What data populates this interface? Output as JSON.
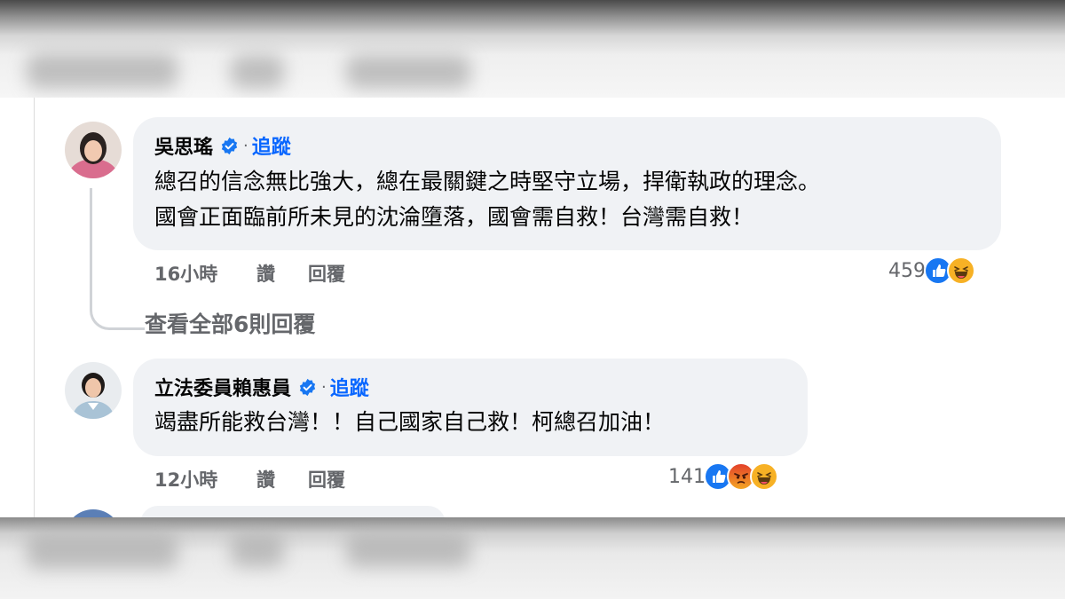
{
  "comments": [
    {
      "author": "吳思瑤",
      "follow": "追蹤",
      "separator": "·",
      "lines": [
        "總召的信念無比強大，總在最關鍵之時堅守立場，捍衛執政的理念。",
        "國會正面臨前所未見的沈淪墮落，國會需自救！台灣需自救！"
      ],
      "time": "16小時",
      "like": "讚",
      "reply": "回覆",
      "reaction_count": "459",
      "reactions": [
        "like-icon",
        "haha-icon"
      ],
      "view_replies": "查看全部6則回覆"
    },
    {
      "author": "立法委員賴惠員",
      "follow": "追蹤",
      "separator": "·",
      "lines": [
        "竭盡所能救台灣！！自己國家自己救！柯總召加油！"
      ],
      "time": "12小時",
      "like": "讚",
      "reply": "回覆",
      "reaction_count": "141",
      "reactions": [
        "like-icon",
        "angry-icon",
        "haha-icon"
      ]
    }
  ],
  "colors": {
    "bubble": "#f0f2f5",
    "link": "#0866ff",
    "secondary_text": "#65676b",
    "like": "#1877f2",
    "haha": "#f7b125",
    "angry": "#e9710f"
  }
}
